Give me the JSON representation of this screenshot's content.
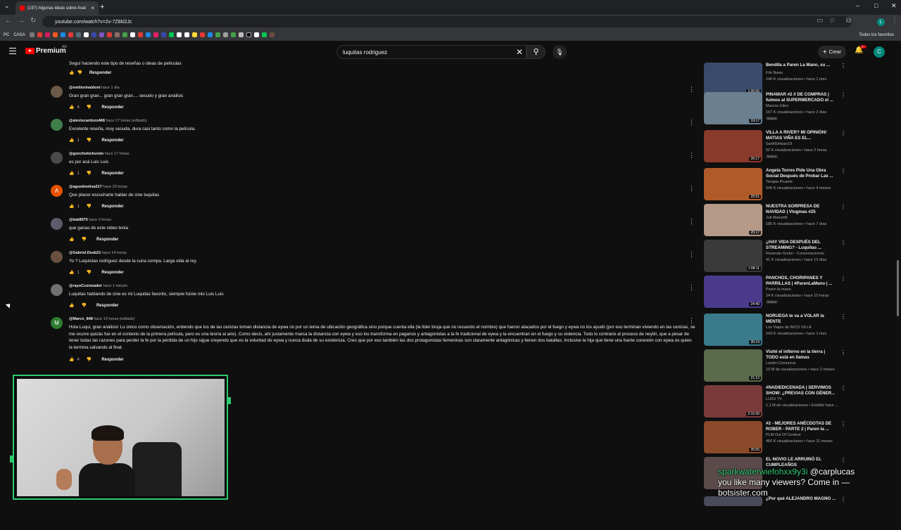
{
  "browser": {
    "tab_title": "(197) Algunas ideas sobre Avat",
    "url": "youtube.com/watch?v=2v-7Z8kl2Jc",
    "bookmarks_label": "CASA",
    "pc_label": "PC",
    "all_bookmarks": "Todos los favoritos"
  },
  "youtube": {
    "logo": "Premium",
    "logo_sup": "AR",
    "search_value": "luquitas rodriguez",
    "create_label": "Crear",
    "notif_count": "9+",
    "avatar_letter": "C"
  },
  "comments": [
    {
      "user": "",
      "time": "",
      "text": "Seguí haciendo este tipo de reseñas o ideas de películas",
      "likes": "",
      "reply": "Responder",
      "avatar_color": "#555555",
      "avatar_letter": ""
    },
    {
      "user": "@emiliorinaldoni",
      "time": "hace 1 día",
      "text": "Gran gran gran... gran gran gran.... sesudo y gran análisis",
      "likes": "4",
      "reply": "Responder",
      "avatar_color": "#6d5a4a",
      "avatar_letter": ""
    },
    {
      "user": "@alexiscardozo468",
      "time": "hace 17 horas (editado)",
      "text": "Excelente reseña, muy sesuda, dura casi tanto como la película.",
      "likes": "1",
      "reply": "Responder",
      "avatar_color": "#3f7f4a",
      "avatar_letter": ""
    },
    {
      "user": "@gonchokickvodo",
      "time": "hace 17 horas",
      "text": "es por acá Luis Luis",
      "likes": "1",
      "reply": "Responder",
      "avatar_color": "#4a4a4a",
      "avatar_letter": ""
    },
    {
      "user": "@agustinoliva217",
      "time": "hace 23 horas",
      "text": "Que placer escucharte hablar de cine luquitas",
      "likes": "1",
      "reply": "Responder",
      "avatar_color": "#e65100",
      "avatar_letter": "A"
    },
    {
      "user": "@kak8975",
      "time": "hace 3 horas",
      "text": "que ganas de este video tenia",
      "likes": "",
      "reply": "Responder",
      "avatar_color": "#5b5b6b",
      "avatar_letter": ""
    },
    {
      "user": "@Gabriel.Desb21",
      "time": "hace 14 horas",
      "text": "Yo ? Luquistas rodriguez desde la cuna compa. Larga vida al rey.",
      "likes": "1",
      "reply": "Responder",
      "avatar_color": "#6a5040",
      "avatar_letter": ""
    },
    {
      "user": "@rayoCconizador",
      "time": "hace 1 minuto",
      "text": "Luquitas hablando de cine es mi Luquitas favorito, siempre fuiste mio Luis Luis",
      "likes": "",
      "reply": "Responder",
      "avatar_color": "#707070",
      "avatar_letter": ""
    },
    {
      "user": "@Marco_848",
      "time": "hace 10 horas (editado)",
      "text": "Hola Luqui, gran análisis! Lo único como observación, entiendo que los de las cenizas toman distancia de eywa no por un tema de ubicación geográfica sino porque cuenta ella (la líder bruja que no recuerdo el nombre) que fueron atacados por el fuego y eywa no los ayudó (por eso terminan viviendo en las cenizas, se me ocurre quizás fue en el contexto de la primera película, pero es una teoría al aire). Como decís, ahí justamente marca la distancia con eywa y eso los transforma en paganos y antagonistas a la fe tradicional de eywa y la encuentran en el fuego y su violencia. Todo lo contrario al proceso de neytiri, que a pesar de tener todas las razones para perder la fe por la pérdida de un hijo sigue creyendo que es la voluntad de eywa y nunca duda de su existencia. Creo que por eso también las dos protagonistas femeninas son claramente antagónicas y tienen dos batallas. Inclusive la hija que tiene una fuerte conexión con eywa es quien la termina salvando al final.",
      "likes": "4",
      "reply": "Responder",
      "avatar_color": "#2e7d32",
      "avatar_letter": "M"
    }
  ],
  "sidebar": [
    {
      "title": "Bendita a Paren La Mano, su ...",
      "channel": "Filo News",
      "views": "246 K visualizaciones • hace 1 mes",
      "duration": "1:06:56",
      "badge": "",
      "thumb": "#3a4a6a"
    },
    {
      "title": "PINAMAR #2 // DE COMPRAS | fuimos al SUPERMERCADO el ...",
      "channel": "Marcos Giles",
      "views": "167 K visualizaciones • hace 2 días",
      "duration": "19:17",
      "badge": "Nuevo",
      "thumb": "#6a7f8f"
    },
    {
      "title": "VILLA A RIVER? MI OPINIÓN! MATIAS VIÑA ES EL...",
      "channel": "SantiGiritzas19",
      "views": "52 K visualizaciones • hace 2 horas",
      "duration": "26:17",
      "badge": "Nuevo",
      "thumb": "#8a3a2a"
    },
    {
      "title": "Angela Torres Pide Una Obra Social Después de Probar Las ...",
      "channel": "Terapia Picante",
      "views": "645 K visualizaciones • hace 4 meses",
      "duration": "25:51",
      "badge": "",
      "thumb": "#b05a2a"
    },
    {
      "title": "NUESTRA SORPRESA DE NAVIDAD | Vlogmas #25",
      "channel": "Juli Manzotti",
      "views": "185 K visualizaciones • hace 7 días",
      "duration": "25:17",
      "badge": "",
      "thumb": "#b59a88"
    },
    {
      "title": "¿HAY VIDA DESPUÉS DEL STREAMING? - Luquitas ...",
      "channel": "Rosendo Grobo - Conversaciones",
      "views": "41 K visualizaciones • hace 13 días",
      "duration": "1:08:11",
      "badge": "",
      "thumb": "#3a3a3a"
    },
    {
      "title": "PANCHOS, CHORIPANES Y PARRILLAS | #ParenLaMano | ...",
      "channel": "Paren la mano",
      "views": "24 K visualizaciones • hace 10 horas",
      "duration": "24:40",
      "badge": "Nuevo",
      "thumb": "#4a3a8a"
    },
    {
      "title": "NORUEGA te va a VOLAR la MENTE",
      "channel": "Los Viajes de NICO VILLA",
      "views": "243 K visualizaciones • hace 1 mes",
      "duration": "35:19",
      "badge": "",
      "thumb": "#3a7a8a"
    },
    {
      "title": "Visité el infierno en la tierra | TODO está en llamas",
      "channel": "Luisito Comunica",
      "views": "10 M de visualizaciones • hace 2 meses",
      "duration": "21:12",
      "badge": "",
      "thumb": "#5a6a4a"
    },
    {
      "title": "#NADIEDICENADA | SERVIMOS SHOW: ¿PREVIAS CON GÉNER...",
      "channel": "LUZU TV",
      "views": "1,1 M de visualizaciones • Emitido hace ...",
      "duration": "2:10:30",
      "badge": "",
      "thumb": "#7a3a3a"
    },
    {
      "title": "#2 - MEJORES ANÉCDOTAS DE ROBER - PARTE 2 | Paren la ...",
      "channel": "PLM Out Of Context",
      "views": "466 K visualizaciones • hace 11 meses",
      "duration": "35:55",
      "badge": "",
      "thumb": "#8a4a2a"
    },
    {
      "title": "EL NOVIO LE ARRUINÓ EL CUMPLEAÑOS",
      "channel": "",
      "views": "",
      "duration": "",
      "badge": "",
      "thumb": "#5a4a4a"
    },
    {
      "title": "¿Por qué ALEJANDRO MAGNO ...",
      "channel": "",
      "views": "",
      "duration": "",
      "badge": "",
      "thumb": "#4a4a5a"
    }
  ],
  "overlay": {
    "user1": "sparkwaterwiefohxx9y3i",
    "user2": "@carplucas",
    "message": "you like many viewers? Come in — botsister.com"
  }
}
